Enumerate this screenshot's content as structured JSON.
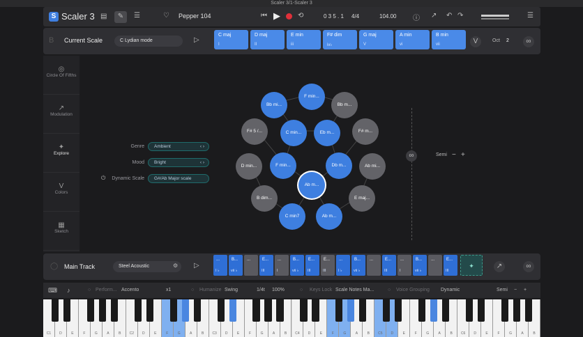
{
  "window": {
    "title": "Scaler 3/1-Scaler 3"
  },
  "topbar": {
    "app_name": "Scaler 3",
    "preset_name": "Pepper 104",
    "position": "0 3 5 . 1",
    "time_signature": "4/4",
    "bpm": "104.00"
  },
  "scale_bar": {
    "letter": "B",
    "title": "Current Scale",
    "scale_value": "C Lydian mode",
    "oct_label": "Oct",
    "oct_value": "2",
    "chords": [
      {
        "name": "C maj",
        "roman": "I"
      },
      {
        "name": "D maj",
        "roman": "II"
      },
      {
        "name": "E min",
        "roman": "iii"
      },
      {
        "name": "F# dim",
        "roman": "iv♭"
      },
      {
        "name": "G maj",
        "roman": "V"
      },
      {
        "name": "A min",
        "roman": "vi"
      },
      {
        "name": "B min",
        "roman": "vii"
      }
    ]
  },
  "sidebar": {
    "items": [
      {
        "label": "Circle Of Fifths",
        "icon": "circle-icon"
      },
      {
        "label": "Modulation",
        "icon": "modulation-icon"
      },
      {
        "label": "Explore",
        "icon": "bulb-icon"
      },
      {
        "label": "Colors",
        "icon": "colors-icon"
      },
      {
        "label": "Sketch",
        "icon": "grid-icon"
      }
    ]
  },
  "explore": {
    "genre_label": "Genre",
    "genre_value": "Ambient",
    "mood_label": "Mood",
    "mood_value": "Bright",
    "dyn_label": "Dynamic Scale",
    "dyn_value": "G#/Ab Major scale",
    "semi_label": "Semi",
    "nodes": [
      {
        "label": "F min...",
        "color": "blue"
      },
      {
        "label": "Bb mi...",
        "color": "blue"
      },
      {
        "label": "Bb m...",
        "color": "grey"
      },
      {
        "label": "F# 5 /...",
        "color": "grey"
      },
      {
        "label": "C min...",
        "color": "blue"
      },
      {
        "label": "Eb m...",
        "color": "blue"
      },
      {
        "label": "F# m...",
        "color": "grey"
      },
      {
        "label": "D min...",
        "color": "grey"
      },
      {
        "label": "F min...",
        "color": "blue"
      },
      {
        "label": "Ab m...",
        "color": "sel"
      },
      {
        "label": "Db m...",
        "color": "blue"
      },
      {
        "label": "Ab mi...",
        "color": "grey"
      },
      {
        "label": "B dim...",
        "color": "grey"
      },
      {
        "label": "E maj...",
        "color": "grey"
      },
      {
        "label": "C min7",
        "color": "blue"
      },
      {
        "label": "Ab m...",
        "color": "blue"
      }
    ]
  },
  "track": {
    "title": "Main Track",
    "instrument": "Steel Acoustic",
    "chords": [
      {
        "n": "...",
        "r": "I ♭",
        "g": false
      },
      {
        "n": "B...",
        "r": "vii ♭",
        "g": false
      },
      {
        "n": "...",
        "r": "",
        "g": true
      },
      {
        "n": "E...",
        "r": "III",
        "g": false
      },
      {
        "n": "...",
        "r": "I",
        "g": true
      },
      {
        "n": "B...",
        "r": "vii ♭",
        "g": false
      },
      {
        "n": "E...",
        "r": "III",
        "g": false
      },
      {
        "n": "E...",
        "r": "III",
        "g": true
      },
      {
        "n": "...",
        "r": "I ♭",
        "g": false
      },
      {
        "n": "B...",
        "r": "vii ♭",
        "g": false
      },
      {
        "n": "...",
        "r": "",
        "g": true
      },
      {
        "n": "E...",
        "r": "III",
        "g": false
      },
      {
        "n": "...",
        "r": "I",
        "g": true
      },
      {
        "n": "B...",
        "r": "vii ♭",
        "g": false
      },
      {
        "n": "...",
        "r": "",
        "g": true
      },
      {
        "n": "E...",
        "r": "III",
        "g": false
      }
    ]
  },
  "controls": {
    "perform_label": "Perform...",
    "perform_value": "Accento",
    "mult": "x1",
    "humanize_label": "Humanize",
    "humanize_value": "Swing",
    "div": "1/4t",
    "pct": "100%",
    "keyslock_label": "Keys Lock",
    "keyslock_value": "Scale Notes Ma...",
    "voice_label": "Voice Grouping",
    "voice_value": "Dynamic",
    "semi_label": "Semi"
  },
  "keyboard": {
    "white_labels": [
      "C1",
      "D",
      "E",
      "F",
      "G",
      "A",
      "B",
      "C2",
      "D",
      "E",
      "F",
      "G",
      "A",
      "B",
      "C3",
      "D",
      "E",
      "F",
      "G",
      "A",
      "B",
      "C4",
      "D",
      "E",
      "F",
      "G",
      "A",
      "B",
      "C5",
      "D",
      "E",
      "F",
      "G",
      "A",
      "B",
      "C6",
      "D",
      "E",
      "F",
      "G",
      "A",
      "B"
    ]
  }
}
